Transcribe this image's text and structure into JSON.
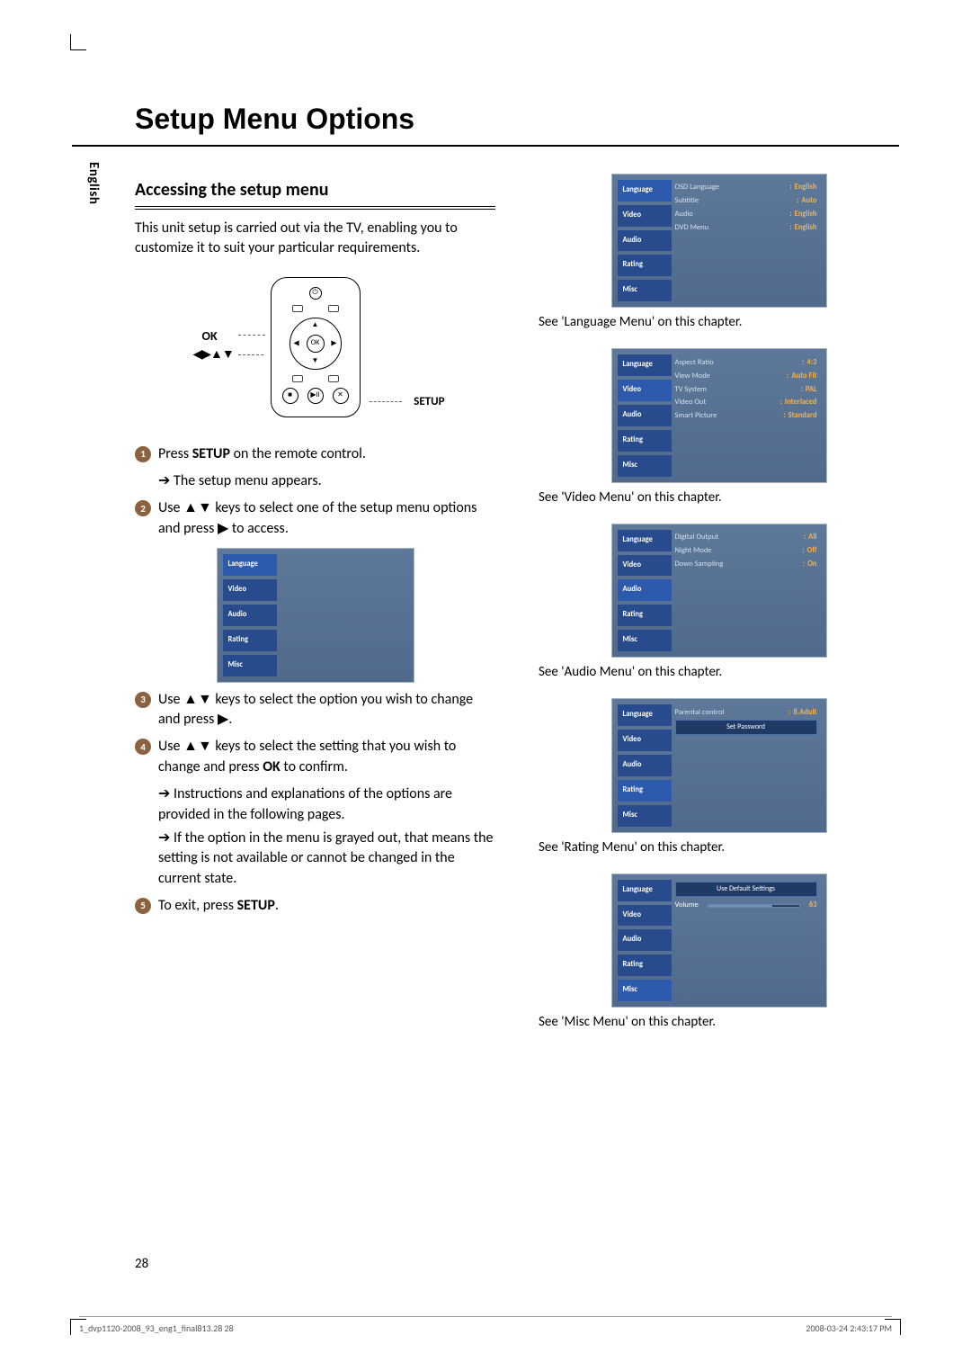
{
  "sidebar_lang": "English",
  "title": "Setup Menu Options",
  "section_title": "Accessing the setup menu",
  "intro": "This unit setup is carried out via the TV, enabling you to customize it to suit your particular requirements.",
  "diagram": {
    "ok": "OK",
    "arrows": "◀▶▲▼",
    "setup": "SETUP"
  },
  "steps": {
    "s1_a": "Press ",
    "s1_b": "SETUP",
    "s1_c": " on the remote control.",
    "s1_sub": "The setup menu appears.",
    "s2": "Use ▲▼ keys to select one of the setup menu options and press ▶ to access.",
    "s3": "Use ▲▼ keys to select the option you wish to change and press ▶.",
    "s4_a": "Use ▲▼ keys to select the setting that you wish to change and press ",
    "s4_b": "OK",
    "s4_c": " to confirm.",
    "s4_sub1": "Instructions and explanations of the options are provided in the following pages.",
    "s4_sub2": "If the option in the menu is grayed out, that means the setting is not available or cannot be changed in the current state.",
    "s5_a": "To exit, press ",
    "s5_b": "SETUP",
    "s5_c": "."
  },
  "tabs": [
    "Language",
    "Video",
    "Audio",
    "Rating",
    "Misc"
  ],
  "menus": {
    "language": {
      "rows": [
        {
          "k": "OSD Language",
          "v": "English"
        },
        {
          "k": "Subtitle",
          "v": "Auto"
        },
        {
          "k": "Audio",
          "v": "English"
        },
        {
          "k": "DVD Menu",
          "v": "English"
        }
      ]
    },
    "video": {
      "rows": [
        {
          "k": "Aspect Ratio",
          "v": "4:3"
        },
        {
          "k": "View Mode",
          "v": "Auto Fit"
        },
        {
          "k": "TV System",
          "v": "PAL"
        },
        {
          "k": "Video Out",
          "v": "Interlaced"
        },
        {
          "k": "Smart Picture",
          "v": "Standard"
        }
      ]
    },
    "audio": {
      "rows": [
        {
          "k": "Digital Output",
          "v": "All"
        },
        {
          "k": "Night Mode",
          "v": "Off"
        },
        {
          "k": "Down Sampling",
          "v": "On"
        }
      ]
    },
    "rating": {
      "rows": [
        {
          "k": "Parental control",
          "v": "8.Adult"
        }
      ],
      "banner": "Set Password"
    },
    "misc": {
      "banner": "Use Default Settings",
      "volume_label": "Volume",
      "volume_value": "63"
    }
  },
  "captions": {
    "language": "See 'Language Menu' on this chapter.",
    "video": "See 'Video Menu' on this chapter.",
    "audio": "See 'Audio Menu' on this chapter.",
    "rating": "See 'Rating Menu' on this chapter.",
    "misc": "See 'Misc Menu' on this chapter."
  },
  "page_number": "28",
  "footer": {
    "left": "1_dvp1120-2008_93_eng1_final813.28   28",
    "right": "2008-03-24   2:43:17 PM"
  }
}
